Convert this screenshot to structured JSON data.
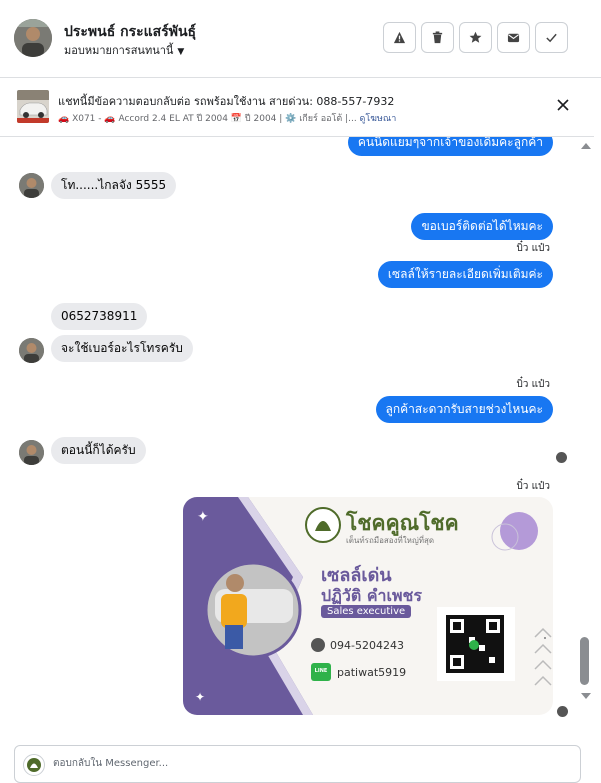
{
  "header": {
    "contact_name": "ประพนธ์ กระแสร์พันธุ์",
    "assign_label": "มอบหมายการสนทนานี้",
    "actions": [
      "warning-icon",
      "trash-icon",
      "star-icon",
      "envelope-icon",
      "check-icon"
    ]
  },
  "topic": {
    "title": "แชทนี้มีข้อความตอบกลับต่อ รถพร้อมใช้งาน สายด่วน: 088-557-7932",
    "meta_text": "🚗 X071 - 🚗 Accord 2.4 EL AT ปี 2004 📅 ปี 2004 | ⚙️ เกียร์ ออโต้ |... ",
    "meta_link": "ดูโฆษณา"
  },
  "messages": [
    {
      "dir": "out",
      "text": "คนนิดแยมๆจากเจ้าของเดิมคะลูกค้า"
    },
    {
      "dir": "in",
      "text": "โท......ไกลจัง 5555"
    },
    {
      "dir": "out",
      "text": "ขอเบอร์ติดต่อได้ไหมคะ"
    },
    {
      "sender": "บิ๋ว แป๋ว"
    },
    {
      "dir": "out",
      "text": "เซลล์ให้รายละเอียดเพิ่มเติมค่ะ"
    },
    {
      "dir": "in",
      "text": "0652738911"
    },
    {
      "dir": "in",
      "text": "จะใช้เบอร์อะไรโทรครับ"
    },
    {
      "sender": "บิ๋ว แป๋ว"
    },
    {
      "dir": "out",
      "text": "ลูกค้าสะดวกรับสายช่วงไหนคะ"
    },
    {
      "dir": "in",
      "text": "ตอนนี้ก็ได้ครับ"
    },
    {
      "sender": "บิ๋ว แป๋ว"
    }
  ],
  "card": {
    "brand": "โชคคูณโชค",
    "tagline": "เต็นท์รถมือสองที่ใหญ่ที่สุด",
    "role": "เซลล์เด่น",
    "person": "ปฏิวัติ  คำเพชร",
    "title_badge": "Sales executive",
    "phone": "094-5204243",
    "line_id": "patiwat5919",
    "line_badge": "LINE",
    "colors": {
      "purple": "#6a5a9c",
      "olive": "#4f6b2a",
      "light_purple": "#b49ad8"
    }
  },
  "composer": {
    "placeholder": "ตอบกลับใน Messenger..."
  }
}
